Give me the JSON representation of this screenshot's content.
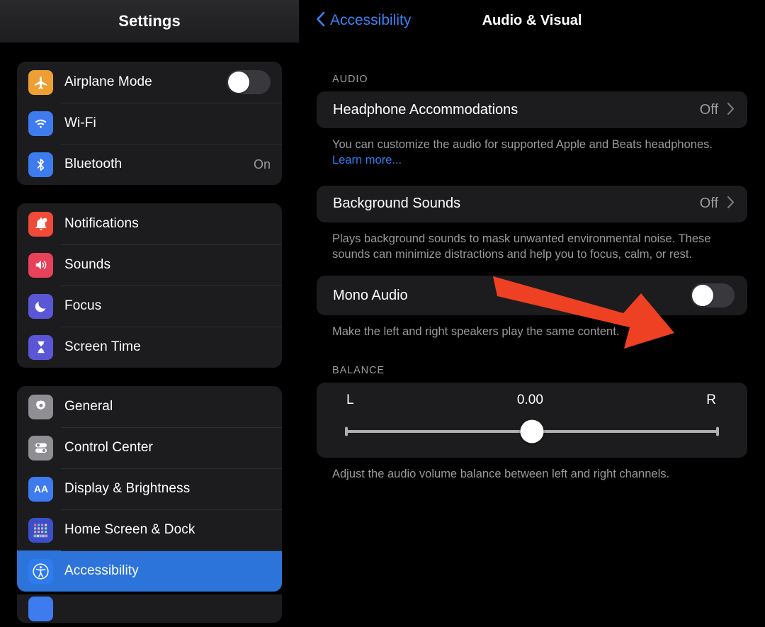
{
  "sidebar": {
    "title": "Settings",
    "groups": [
      {
        "name": "connectivity",
        "items": [
          {
            "label": "Airplane Mode",
            "icon": "airplane-icon",
            "control": "toggle",
            "toggle_on": false,
            "icon_color": "#EE9F33"
          },
          {
            "label": "Wi-Fi",
            "icon": "wifi-icon",
            "control": "none",
            "value": "",
            "icon_color": "#3D7BEF"
          },
          {
            "label": "Bluetooth",
            "icon": "bluetooth-icon",
            "control": "value",
            "value": "On",
            "icon_color": "#3D7BEF"
          }
        ]
      },
      {
        "name": "alerts",
        "items": [
          {
            "label": "Notifications",
            "icon": "bell-icon",
            "control": "none",
            "value": "",
            "icon_color": "#F04A38"
          },
          {
            "label": "Sounds",
            "icon": "speaker-icon",
            "control": "none",
            "value": "",
            "icon_color": "#E8415A"
          },
          {
            "label": "Focus",
            "icon": "moon-icon",
            "control": "none",
            "value": "",
            "icon_color": "#5A56D6"
          },
          {
            "label": "Screen Time",
            "icon": "hourglass-icon",
            "control": "none",
            "value": "",
            "icon_color": "#5A56D6"
          }
        ]
      },
      {
        "name": "system",
        "items": [
          {
            "label": "General",
            "icon": "gear-icon",
            "control": "none",
            "value": "",
            "icon_color": "#8E8E93",
            "selected": false
          },
          {
            "label": "Control Center",
            "icon": "control-center-icon",
            "control": "none",
            "value": "",
            "icon_color": "#8E8E93",
            "selected": false
          },
          {
            "label": "Display & Brightness",
            "icon": "display-brightness-icon",
            "control": "none",
            "value": "",
            "icon_color": "#3D7BEF",
            "selected": false
          },
          {
            "label": "Home Screen & Dock",
            "icon": "home-screen-icon",
            "control": "none",
            "value": "",
            "icon_color": "#3C4FCB",
            "selected": false
          },
          {
            "label": "Accessibility",
            "icon": "accessibility-icon",
            "control": "none",
            "value": "",
            "icon_color": "#2E7BF0",
            "selected": true
          }
        ]
      }
    ],
    "selected_item": "Accessibility",
    "selection_color": "#2d74da"
  },
  "detail": {
    "back_label": "Accessibility",
    "title": "Audio & Visual",
    "sections": [
      {
        "header": "AUDIO",
        "rows": [
          {
            "label": "Headphone Accommodations",
            "value": "Off",
            "type": "disclosure"
          }
        ],
        "footnote": "You can customize the audio for supported Apple and Beats headphones. ",
        "footnote_link": "Learn more..."
      },
      {
        "header": "",
        "rows": [
          {
            "label": "Background Sounds",
            "value": "Off",
            "type": "disclosure"
          }
        ],
        "footnote": "Plays background sounds to mask unwanted environmental noise. These sounds can minimize distractions and help you to focus, calm, or rest.",
        "footnote_link": ""
      },
      {
        "header": "",
        "rows": [
          {
            "label": "Mono Audio",
            "value": "",
            "type": "toggle",
            "toggle_on": false
          }
        ],
        "footnote": "Make the left and right speakers play the same content.",
        "footnote_link": ""
      }
    ],
    "balance": {
      "header": "BALANCE",
      "left_label": "L",
      "right_label": "R",
      "value": "0.00",
      "position_percent": 50,
      "footnote": "Adjust the audio volume balance between left and right channels."
    }
  },
  "annotation": {
    "type": "arrow",
    "color": "#EE4023",
    "points_at": "mono-audio-toggle"
  }
}
